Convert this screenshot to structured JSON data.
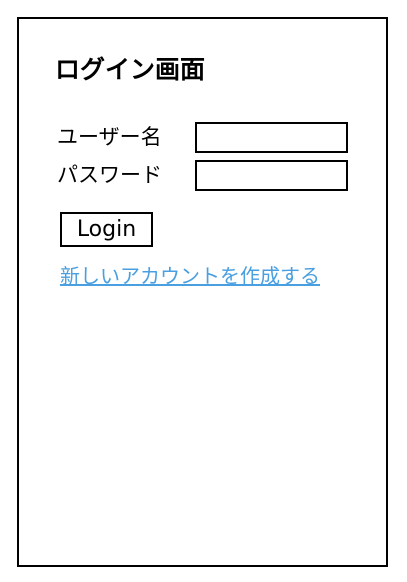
{
  "login_form": {
    "title": "ログイン画面",
    "username_label": "ユーザー名",
    "username_value": "",
    "password_label": "パスワード",
    "password_value": "",
    "login_button_label": "Login",
    "signup_link_text": "新しいアカウントを作成する"
  },
  "colors": {
    "link": "#4a9fe0",
    "border": "#000000",
    "background": "#ffffff"
  }
}
